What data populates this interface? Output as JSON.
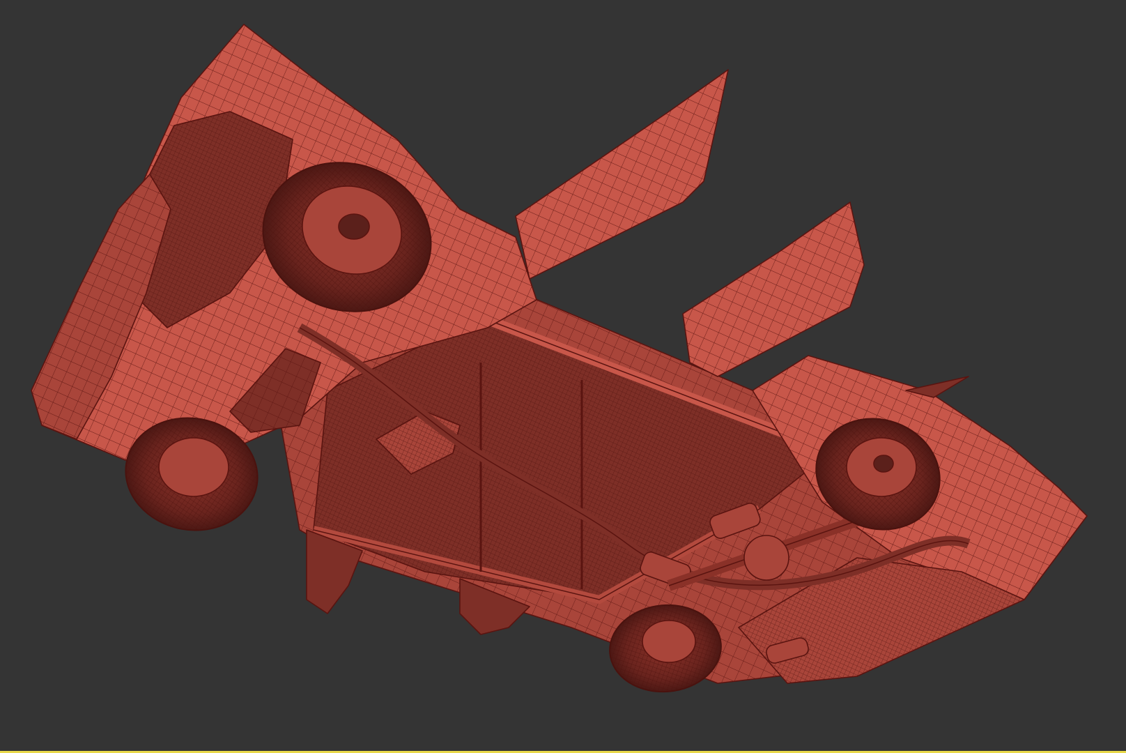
{
  "viewport": {
    "background": "#343434",
    "active_border_color": "#e8d84a"
  },
  "model": {
    "wire_color": "#5a1410",
    "surface_light": "#c8574a",
    "surface_mid": "#a9453a",
    "surface_dark": "#7e2f27",
    "surface_deep": "#5b201b",
    "parts": [
      "front-bumper",
      "chassis-frame",
      "rear-body",
      "open-door-left",
      "open-door-right",
      "front-left-wheel",
      "front-right-wheel",
      "rear-left-wheel",
      "rear-right-wheel",
      "exhaust-pipe",
      "fuel-tank",
      "rear-axle"
    ]
  }
}
